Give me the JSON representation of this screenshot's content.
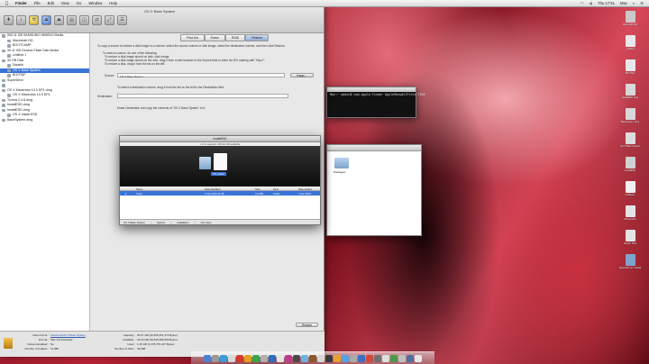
{
  "menubar": {
    "apple": "",
    "app": "Finder",
    "items": [
      "File",
      "Edit",
      "View",
      "Go",
      "Window",
      "Help"
    ],
    "clock": "Thu 17:51",
    "user": "Mac"
  },
  "disk_utility": {
    "title": "OS X Base System",
    "tabs": [
      "First Aid",
      "Erase",
      "RAID",
      "Restore"
    ],
    "sidebar": [
      {
        "label": "500.11 GB SAMSUNG HM500JI Media",
        "sel": false,
        "indent": false
      },
      {
        "label": "Macintosh HD",
        "sel": false,
        "indent": true
      },
      {
        "label": "BOOTCAMP",
        "sel": false,
        "indent": true
      },
      {
        "label": "30.11 GB Generic Flash Disk Media",
        "sel": false,
        "indent": false
      },
      {
        "label": "Untitled 1",
        "sel": false,
        "indent": true
      },
      {
        "label": "30 GB Disk",
        "sel": false,
        "indent": false
      },
      {
        "label": "Disable",
        "sel": false,
        "indent": true
      },
      {
        "label": "OS X Base System",
        "sel": true,
        "indent": true
      },
      {
        "label": "BOOTAF",
        "sel": false,
        "indent": true
      },
      {
        "label": "SuperDrive",
        "sel": false,
        "indent": false
      },
      {
        "label": "",
        "sel": false,
        "indent": false
      },
      {
        "label": "OS X Mavericks 10.9 DP1.dmg",
        "sel": false,
        "indent": false
      },
      {
        "label": "OS X Mavericks 10.9 DP1",
        "sel": false,
        "indent": true
      },
      {
        "label": "Tuxera 2.4.8.dmg",
        "sel": false,
        "indent": false
      },
      {
        "label": "InstallESD.dmg",
        "sel": false,
        "indent": false
      },
      {
        "label": "InstallESD.dmg",
        "sel": false,
        "indent": false
      },
      {
        "label": "OS X Install ESD",
        "sel": false,
        "indent": true
      },
      {
        "label": "BaseSystem.dmg",
        "sel": false,
        "indent": false
      }
    ],
    "intro": "To copy a source to restore a disk image to a volume, select the source volume or disk image, select the destination volume, and then click Restore.",
    "intro_items": [
      "To select a source, do one of the following:",
      "To restore a disk image stored on disk, click Image.",
      "To restore a disk image stored on the web, drag it from a web browser to the Source field or enter its URL starting with \"http://\".",
      "To restore a disk, drag it from the list on the left."
    ],
    "source_label": "Source:",
    "source_value": "OS X Base System",
    "image_button": "Image...",
    "dest_intro": "To select a destination volume, drag it from the list on the left to the Destination field.",
    "destination_label": "Destination:",
    "erase_text": "Erase Destination and copy the contents of \"OS X Base System\" to it.",
    "restore_button": "Restore",
    "bottom": {
      "mount_label": "Mount Point :",
      "mount_value": "/Volumes/OS X Base System",
      "format_label": "Format :",
      "format_value": "Mac OS Extended",
      "owners_label": "Owners Enabled :",
      "owners_value": "No",
      "folders_label": "Number of Folders :",
      "folders_value": "11,589",
      "capacity_label": "Capacity :",
      "capacity_value": "29.67 GB (29,665,251,373 Bytes)",
      "available_label": "Available :",
      "available_value": "29.63 GB (29,635,489,598 Bytes)",
      "used_label": "Used :",
      "used_value": "1.25 GB (1,378,787,347 Bytes)",
      "files_label": "Number of Files :",
      "files_value": "39,998"
    }
  },
  "terminal": {
    "line": "Mac:~ admin$ com.apple.finder AppleShowAllFiles TRUE"
  },
  "finder_packages": {
    "folder_label": "Packages"
  },
  "finder_main": {
    "title": "InstallESD",
    "status": "1 of 1 selected, 203.92 GB available",
    "selected_label": "OS_Kaco",
    "columns": [
      "Name",
      "Date Modified",
      "Size",
      "Kind",
      "Date Added"
    ],
    "row": [
      "Cmt4",
      "4 Jun 2013 11:58",
      "4.4 MB",
      "Folder",
      "4 Jun 2013"
    ],
    "path": [
      "OS X Base System",
      "System",
      "Installation",
      "OS_Kaco"
    ]
  },
  "desktop_icons": [
    {
      "label": "Macintosh HD",
      "color": "#c8c8c8"
    },
    {
      "label": "Untitled",
      "color": "#e8e8e8"
    },
    {
      "label": "BOOTAF",
      "color": "#e8e8e8"
    },
    {
      "label": "InstallESD.dmg",
      "color": "#d8d8d8"
    },
    {
      "label": "BaseSystem.dmg",
      "color": "#d8d8d8"
    },
    {
      "label": "OS X Base System",
      "color": "#dcdcdc"
    },
    {
      "label": "InstallESD",
      "color": "#d0d0d0"
    },
    {
      "label": "Untitled 1",
      "color": "#f0f0f0"
    },
    {
      "label": "Screenshot",
      "color": "#e4e4e4"
    },
    {
      "label": "Screen Shot",
      "color": "#e4e4e4"
    },
    {
      "label": "Mountain Lion Install",
      "color": "#7fa3cc"
    }
  ],
  "dock_colors": [
    "#4e7fd0",
    "#9a9a9a",
    "#3f9ad6",
    "#d8d8d8",
    "#d23b2b",
    "#e4a020",
    "#3aa84a",
    "#b0b0b0",
    "#2f6dc0",
    "#e6e6e6",
    "#c23a90",
    "#4a4a4a",
    "#6fb2e2",
    "#8a5a2a",
    "#d8d8d8",
    "#3a3a3a",
    "#eaa030",
    "#5aa0e0",
    "#aaaaaa",
    "#3a70c0",
    "#d04a3a",
    "#707070",
    "#e0e0e0",
    "#4a9a4a",
    "#c0c0c0",
    "#5070a0",
    "#e8e8e8"
  ]
}
